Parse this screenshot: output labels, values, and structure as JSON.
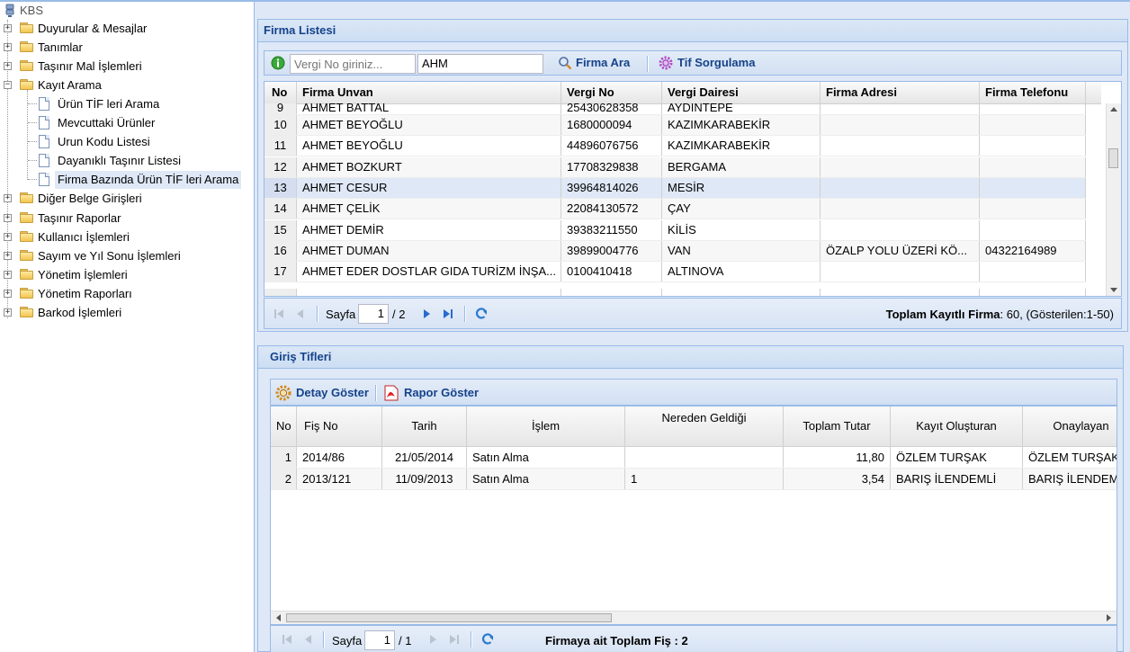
{
  "tree": {
    "root": "KBS",
    "items": [
      {
        "label": "Duyurular & Mesajlar",
        "state": "collapsed"
      },
      {
        "label": "Tanımlar",
        "state": "collapsed"
      },
      {
        "label": "Taşınır Mal İşlemleri",
        "state": "collapsed"
      },
      {
        "label": "Kayıt Arama",
        "state": "expanded",
        "children": [
          {
            "label": "Ürün TİF leri Arama"
          },
          {
            "label": "Mevcuttaki Ürünler"
          },
          {
            "label": "Urun Kodu Listesi"
          },
          {
            "label": "Dayanıklı Taşınır Listesi"
          },
          {
            "label": "Firma Bazında Ürün TİF leri Arama",
            "selected": true
          }
        ]
      },
      {
        "label": "Diğer Belge Girişleri",
        "state": "collapsed"
      },
      {
        "label": "Taşınır Raporlar",
        "state": "collapsed"
      },
      {
        "label": "Kullanıcı İşlemleri",
        "state": "collapsed"
      },
      {
        "label": "Sayım ve Yıl Sonu İşlemleri",
        "state": "collapsed"
      },
      {
        "label": "Yönetim İşlemleri",
        "state": "collapsed"
      },
      {
        "label": "Yönetim Raporları",
        "state": "collapsed"
      },
      {
        "label": "Barkod İşlemleri",
        "state": "collapsed"
      }
    ]
  },
  "firma": {
    "title": "Firma Listesi",
    "search": {
      "vergi_placeholder": "Vergi No giriniz...",
      "name_value": "AHM",
      "find_label": "Firma Ara",
      "tif_label": "Tif Sorgulama"
    },
    "columns": [
      "No",
      "Firma Unvan",
      "Vergi No",
      "Vergi Dairesi",
      "Firma Adresi",
      "Firma Telefonu"
    ],
    "rows": [
      [
        "9",
        "AHMET BATTAL",
        "25430628358",
        "AYDINTEPE",
        "",
        ""
      ],
      [
        "10",
        "AHMET BEYOĞLU",
        "1680000094",
        "KAZIMKARABEKİR",
        "",
        ""
      ],
      [
        "11",
        "AHMET BEYOĞLU",
        "44896076756",
        "KAZIMKARABEKİR",
        "",
        ""
      ],
      [
        "12",
        "AHMET BOZKURT",
        "17708329838",
        "BERGAMA",
        "",
        ""
      ],
      [
        "13",
        "AHMET CESUR",
        "39964814026",
        "MESİR",
        "",
        ""
      ],
      [
        "14",
        "AHMET ÇELİK",
        "22084130572",
        "ÇAY",
        "",
        ""
      ],
      [
        "15",
        "AHMET DEMİR",
        "39383211550",
        "KİLİS",
        "",
        ""
      ],
      [
        "16",
        "AHMET DUMAN",
        "39899004776",
        "VAN",
        "ÖZALP YOLU ÜZERİ KÖ...",
        "04322164989"
      ],
      [
        "17",
        "AHMET EDER DOSTLAR GIDA TURİZM İNŞA...",
        "0100410418",
        "ALTINOVA",
        "",
        ""
      ]
    ],
    "pager": {
      "page_label": "Sayfa",
      "page": "1",
      "of": "/ 2",
      "total_label": "Toplam Kayıtlı Firma",
      "total_value": ": 60, (Gösterilen:1-50)"
    }
  },
  "giris": {
    "title": "Giriş Tifleri",
    "toolbar": {
      "detail_label": "Detay Göster",
      "report_label": "Rapor Göster"
    },
    "columns": [
      "No",
      "Fiş No",
      "Tarih",
      "İşlem",
      "Nereden Geldiği",
      "Toplam Tutar",
      "Kayıt Oluşturan",
      "Onaylayan"
    ],
    "rows": [
      [
        "1",
        "2014/86",
        "21/05/2014",
        "Satın Alma",
        "",
        "11,80",
        "ÖZLEM TURŞAK",
        "ÖZLEM TURŞAK"
      ],
      [
        "2",
        "2013/121",
        "11/09/2013",
        "Satın Alma",
        "1",
        "3,54",
        "BARIŞ İLENDEMLİ",
        "BARIŞ İLENDEMLİ"
      ]
    ],
    "pager": {
      "page_label": "Sayfa",
      "page": "1",
      "of": "/ 1",
      "total_label": "Firmaya ait Toplam Fiş : 2"
    }
  },
  "colors": {
    "accent": "#15428b",
    "border": "#99bbe8",
    "panel_bg": "#dfe8f6"
  }
}
